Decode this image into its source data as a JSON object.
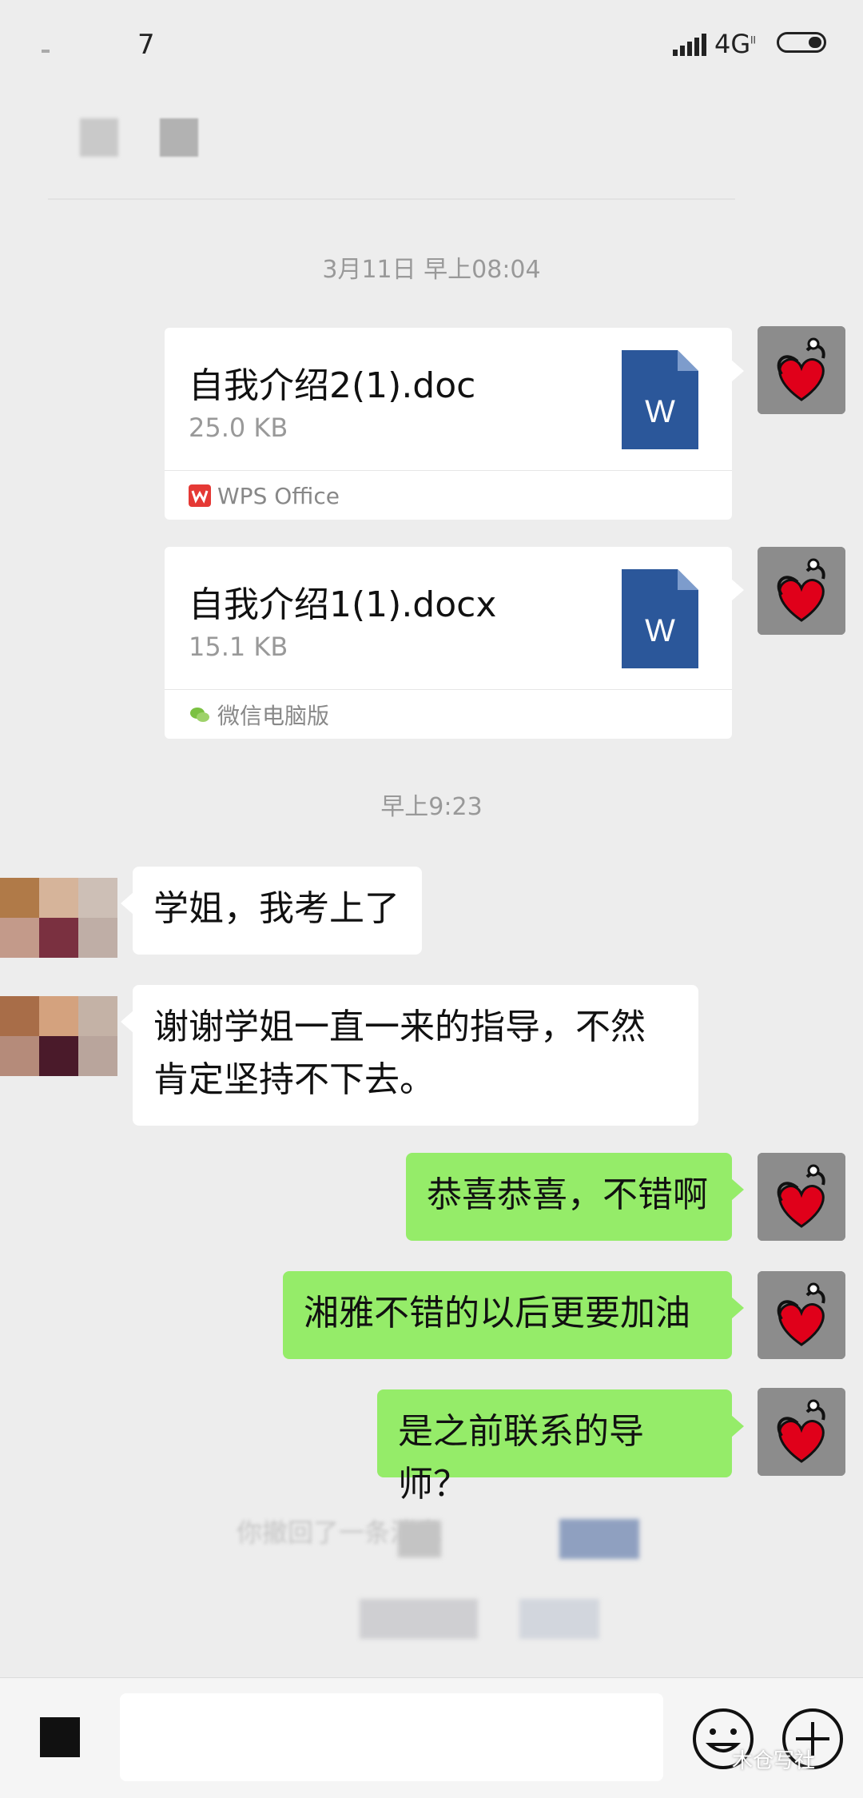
{
  "status_bar": {
    "time": "7",
    "network": "4G",
    "network_sup": "ll"
  },
  "chat": {
    "timestamp_1": "3月11日 早上08:04",
    "files": [
      {
        "name": "自我介绍2(1).doc",
        "size": "25.0 KB",
        "icon_letter": "W",
        "source": "WPS Office"
      },
      {
        "name": "自我介绍1(1).docx",
        "size": "15.1 KB",
        "icon_letter": "W",
        "source": "微信电脑版"
      }
    ],
    "timestamp_2": "早上9:23",
    "messages": [
      {
        "side": "left",
        "text": "学姐，我考上了"
      },
      {
        "side": "left",
        "text": "谢谢学姐一直一来的指导，不然肯定坚持不下去。"
      },
      {
        "side": "right",
        "text": "恭喜恭喜，不错啊"
      },
      {
        "side": "right",
        "text": "湘雅不错的以后更要加油"
      },
      {
        "side": "right",
        "text": "是之前联系的导师？"
      }
    ],
    "recall_notice": "你撤回了一条消息"
  },
  "watermark": "木仓写社",
  "icons": [
    "keyboard-icon",
    "emoji-icon",
    "plus-icon",
    "word-doc-icon",
    "wps-icon",
    "wechat-icon",
    "stethoscope-heart-icon"
  ],
  "colors": {
    "bubble_self": "#95ec69",
    "word_blue": "#2b579a",
    "background": "#ededed"
  }
}
